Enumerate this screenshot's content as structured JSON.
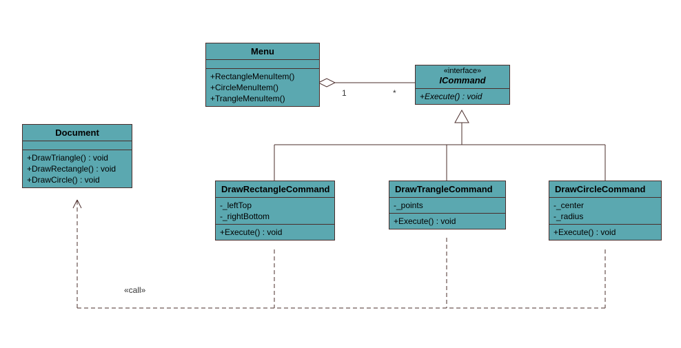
{
  "diagram_type": "uml_class_diagram",
  "classes": {
    "document": {
      "name": "Document",
      "methods": [
        "+DrawTriangle() : void",
        "+DrawRectangle() : void",
        "+DrawCircle() : void"
      ]
    },
    "menu": {
      "name": "Menu",
      "methods": [
        "+RectangleMenuItem()",
        "+CircleMenuItem()",
        "+TrangleMenuItem()"
      ]
    },
    "icommand": {
      "stereotype": "«interface»",
      "name": "ICommand",
      "methods": [
        "+Execute() : void"
      ]
    },
    "drawRectangleCommand": {
      "name": "DrawRectangleCommand",
      "attributes": [
        "-_leftTop",
        "-_rightBottom"
      ],
      "methods": [
        "+Execute() : void"
      ]
    },
    "drawTrangleCommand": {
      "name": "DrawTrangleCommand",
      "attributes": [
        "-_points"
      ],
      "methods": [
        "+Execute() : void"
      ]
    },
    "drawCircleCommand": {
      "name": "DrawCircleCommand",
      "attributes": [
        "-_center",
        "-_radius"
      ],
      "methods": [
        "+Execute() : void"
      ]
    }
  },
  "relationships": {
    "aggregation": {
      "end1_mult": "1",
      "end2_mult": "*"
    },
    "dependency_label": "«call»"
  }
}
